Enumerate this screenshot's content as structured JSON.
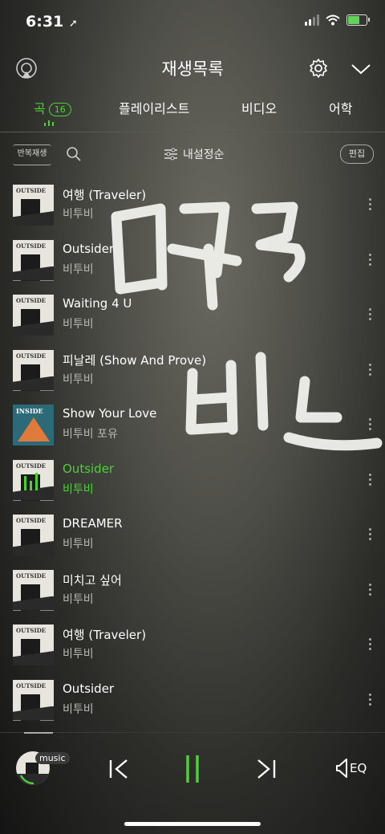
{
  "status": {
    "time": "6:31"
  },
  "header": {
    "title": "재생목록"
  },
  "tabs": [
    {
      "label": "곡",
      "count": "16"
    },
    {
      "label": "플레이리스트"
    },
    {
      "label": "비디오"
    },
    {
      "label": "어학"
    }
  ],
  "toolbar": {
    "repeat_label": "반복재생",
    "sort_label": "내설정순",
    "edit_label": "편집"
  },
  "songs": [
    {
      "title": "여행 (Traveler)",
      "artist": "비투비",
      "art_text": "OUTSIDE"
    },
    {
      "title": "Outsider",
      "artist": "비투비",
      "art_text": "OUTSIDE"
    },
    {
      "title": "Waiting 4 U",
      "artist": "비투비",
      "art_text": "OUTSIDE"
    },
    {
      "title": "피날레 (Show And Prove)",
      "artist": "비투비",
      "art_text": "OUTSIDE"
    },
    {
      "title": "Show Your Love",
      "artist": "비투비 포유",
      "art_text": "INSIDE"
    },
    {
      "title": "Outsider",
      "artist": "비투비",
      "art_text": "OUTSIDE",
      "playing": true
    },
    {
      "title": "DREAMER",
      "artist": "비투비",
      "art_text": "OUTSIDE"
    },
    {
      "title": "미치고 싶어",
      "artist": "비투비",
      "art_text": "OUTSIDE"
    },
    {
      "title": "여행 (Traveler)",
      "artist": "비투비",
      "art_text": "OUTSIDE"
    },
    {
      "title": "Outsider",
      "artist": "비투비",
      "art_text": "OUTSIDE"
    }
  ],
  "player": {
    "badge": "music",
    "eq_label": "EQ"
  },
  "colors": {
    "accent": "#4cd137",
    "background": "#3f3f3b"
  }
}
